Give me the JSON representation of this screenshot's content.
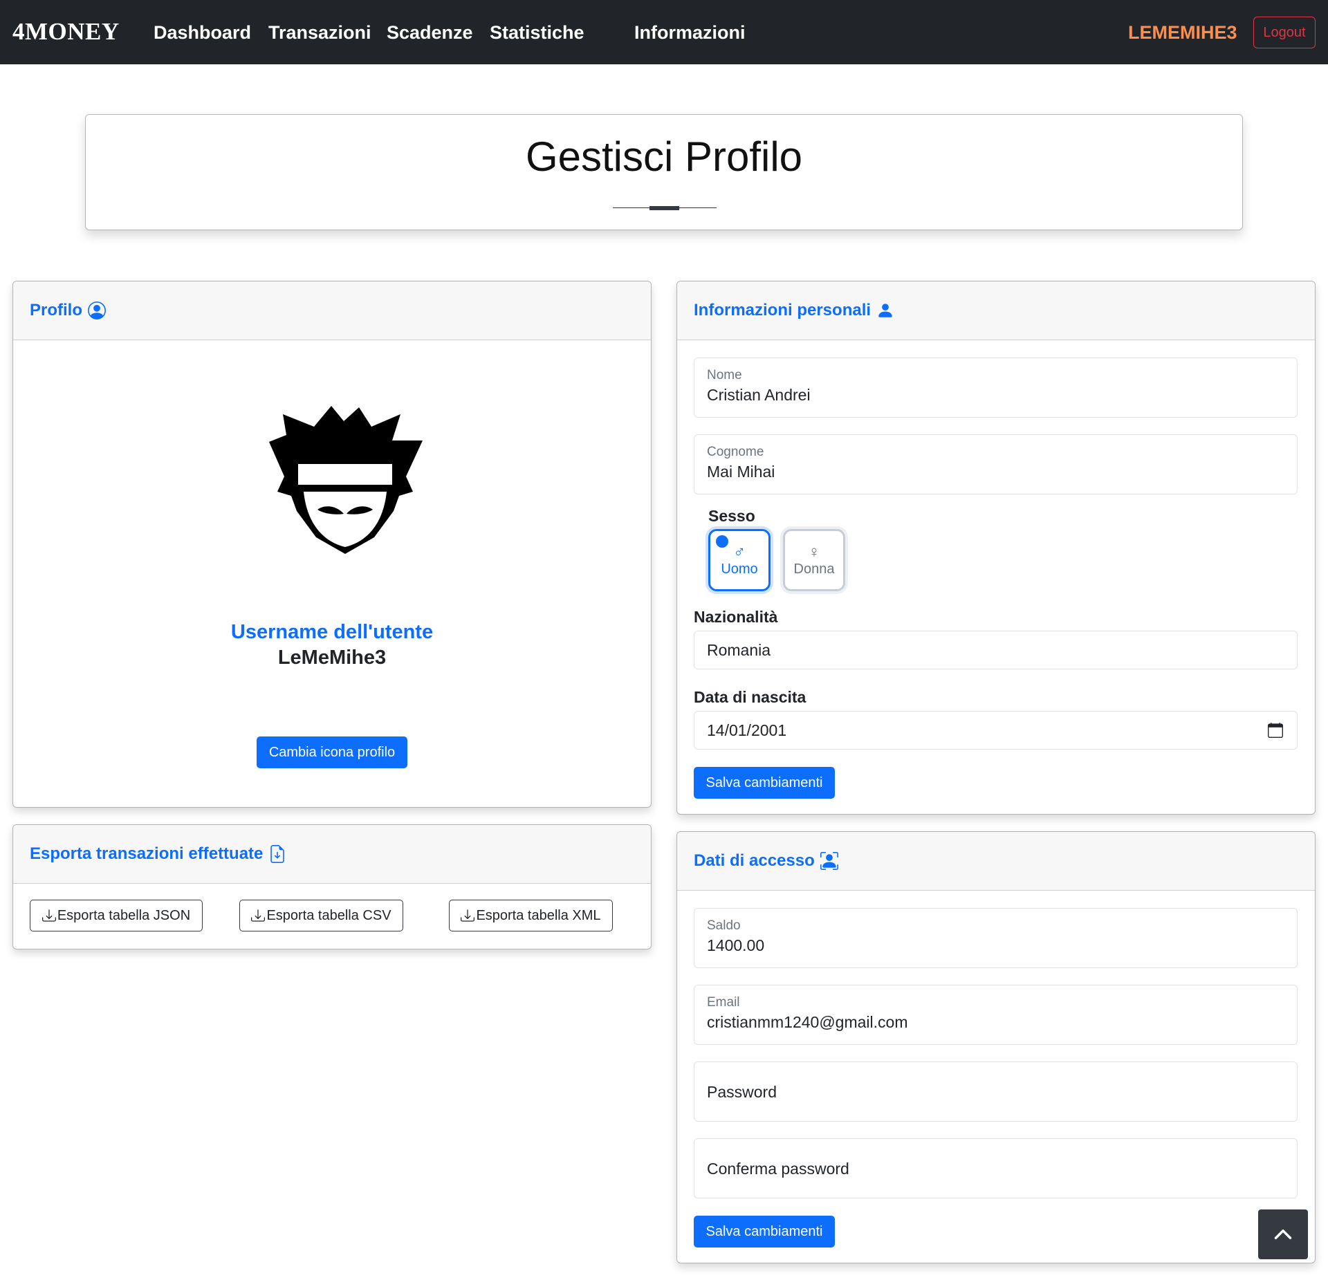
{
  "nav": {
    "brand": "4MONEY",
    "links": [
      "Dashboard",
      "Transazioni",
      "Scadenze",
      "Statistiche",
      "Informazioni"
    ],
    "user": "LEMEMIHE3",
    "logout": "Logout"
  },
  "page_title": "Gestisci Profilo",
  "profile_card": {
    "title": "Profilo",
    "username_label": "Username dell'utente",
    "username": "LeMeMihe3",
    "change_icon_button": "Cambia icona profilo"
  },
  "export_card": {
    "title": "Esporta transazioni effettuate",
    "buttons": [
      "Esporta tabella JSON",
      "Esporta tabella CSV",
      "Esporta tabella XML"
    ]
  },
  "personal_card": {
    "title": "Informazioni personali",
    "nome_label": "Nome",
    "nome_value": "Cristian Andrei",
    "cognome_label": "Cognome",
    "cognome_value": "Mai Mihai",
    "sesso_label": "Sesso",
    "gender_options": [
      {
        "symbol": "♂",
        "label": "Uomo",
        "selected": true
      },
      {
        "symbol": "♀",
        "label": "Donna",
        "selected": false
      }
    ],
    "nazionalita_label": "Nazionalità",
    "nazionalita_value": "Romania",
    "data_nascita_label": "Data di nascita",
    "data_nascita_value": "14/01/2001",
    "save_button": "Salva cambiamenti"
  },
  "access_card": {
    "title": "Dati di accesso",
    "saldo_label": "Saldo",
    "saldo_value": "1400.00",
    "email_label": "Email",
    "email_value": "cristianmm1240@gmail.com",
    "password_placeholder": "Password",
    "confirm_password_placeholder": "Conferma password",
    "save_button": "Salva cambiamenti"
  },
  "colors": {
    "navbar": "#212529",
    "primary": "#0d6efd",
    "user_accent": "#fd8f4c",
    "danger": "#dc3545"
  }
}
